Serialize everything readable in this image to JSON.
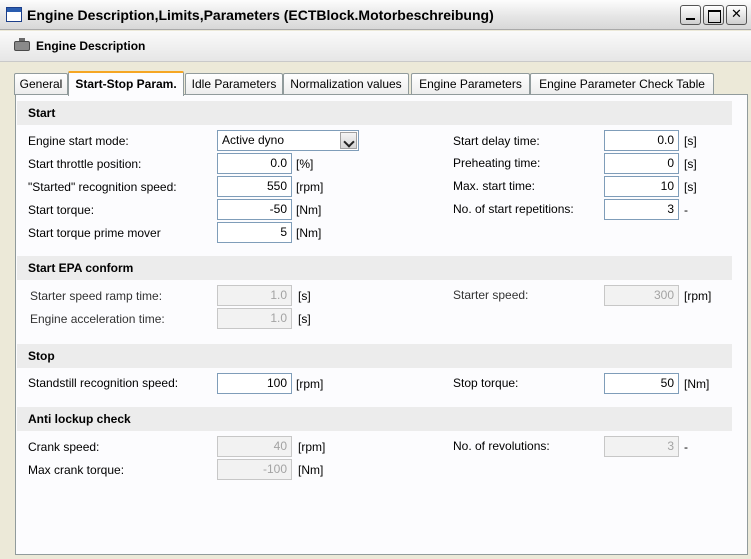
{
  "window": {
    "title": "Engine Description,Limits,Parameters (ECTBlock.Motorbeschreibung)"
  },
  "header": {
    "title": "Engine Description"
  },
  "tabs": [
    {
      "label": "General"
    },
    {
      "label": "Start-Stop Param."
    },
    {
      "label": "Idle Parameters"
    },
    {
      "label": "Normalization values"
    },
    {
      "label": "Engine Parameters"
    },
    {
      "label": "Engine Parameter Check Table"
    }
  ],
  "start": {
    "title": "Start",
    "engine_start_mode": {
      "label": "Engine start mode:",
      "value": "Active dyno"
    },
    "start_throttle": {
      "label": "Start throttle position:",
      "value": "0.0",
      "unit": "[%]"
    },
    "started_speed": {
      "label": "\"Started\" recognition speed:",
      "value": "550",
      "unit": "[rpm]"
    },
    "start_torque": {
      "label": "Start torque:",
      "value": "-50",
      "unit": "[Nm]"
    },
    "start_torque_prime": {
      "label": "Start torque prime mover",
      "value": "5",
      "unit": "[Nm]"
    },
    "start_delay": {
      "label": "Start delay time:",
      "value": "0.0",
      "unit": "[s]"
    },
    "preheating": {
      "label": "Preheating time:",
      "value": "0",
      "unit": "[s]"
    },
    "max_start_time": {
      "label": "Max. start time:",
      "value": "10",
      "unit": "[s]"
    },
    "start_repetitions": {
      "label": "No. of start repetitions:",
      "value": "3",
      "unit": "-"
    }
  },
  "start_epa": {
    "title": "Start EPA conform",
    "ramp_time": {
      "label": "Starter speed ramp time:",
      "value": "1.0",
      "unit": "[s]"
    },
    "accel_time": {
      "label": "Engine acceleration time:",
      "value": "1.0",
      "unit": "[s]"
    },
    "starter_speed": {
      "label": "Starter speed:",
      "value": "300",
      "unit": "[rpm]"
    }
  },
  "stop": {
    "title": "Stop",
    "standstill_speed": {
      "label": "Standstill recognition speed:",
      "value": "100",
      "unit": "[rpm]"
    },
    "stop_torque": {
      "label": "Stop torque:",
      "value": "50",
      "unit": "[Nm]"
    }
  },
  "anti_lockup": {
    "title": "Anti lockup check",
    "crank_speed": {
      "label": "Crank speed:",
      "value": "40",
      "unit": "[rpm]"
    },
    "max_crank_torque": {
      "label": "Max crank torque:",
      "value": "-100",
      "unit": "[Nm]"
    },
    "revolutions": {
      "label": "No. of revolutions:",
      "value": "3",
      "unit": "-"
    }
  }
}
